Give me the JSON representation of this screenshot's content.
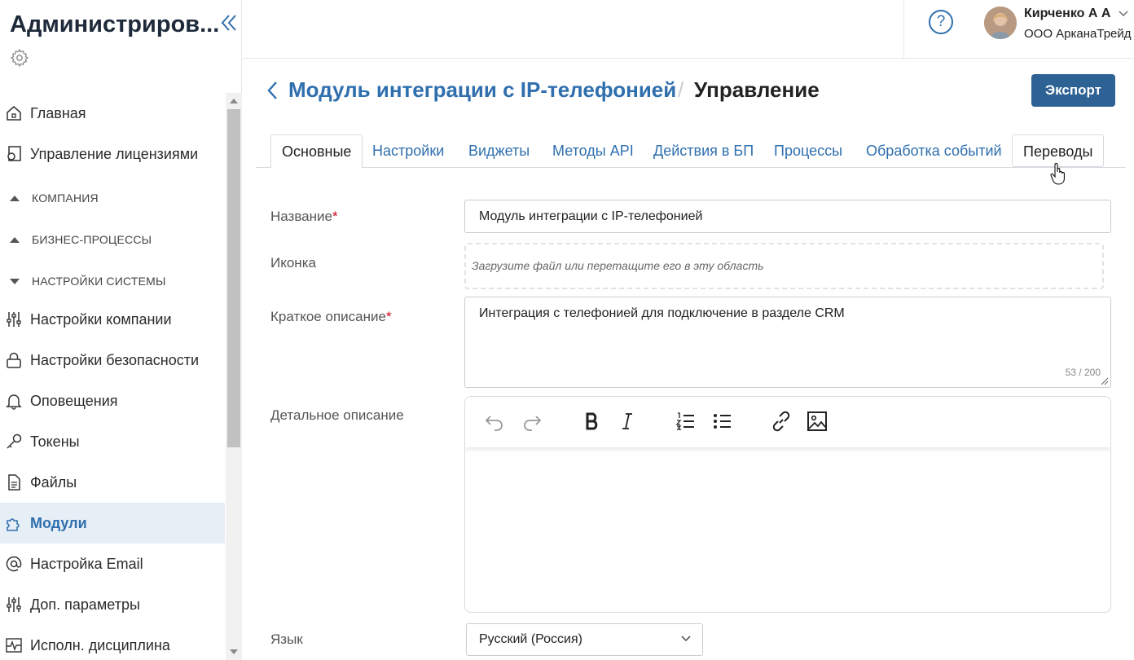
{
  "sidebar": {
    "title": "Администриров...",
    "items": [
      {
        "label": "Главная",
        "icon": "home-icon"
      },
      {
        "label": "Управление лицензиями",
        "icon": "license-icon"
      },
      {
        "label": "КОМПАНИЯ",
        "section": true,
        "state": "collapsed"
      },
      {
        "label": "БИЗНЕС-ПРОЦЕССЫ",
        "section": true,
        "state": "collapsed"
      },
      {
        "label": "НАСТРОЙКИ СИСТЕМЫ",
        "section": true,
        "state": "expanded"
      },
      {
        "label": "Настройки компании",
        "icon": "sliders-icon"
      },
      {
        "label": "Настройки безопасности",
        "icon": "lock-icon"
      },
      {
        "label": "Оповещения",
        "icon": "bell-icon"
      },
      {
        "label": "Токены",
        "icon": "key-icon"
      },
      {
        "label": "Файлы",
        "icon": "file-icon"
      },
      {
        "label": "Модули",
        "icon": "puzzle-icon",
        "active": true
      },
      {
        "label": "Настройка Email",
        "icon": "at-icon"
      },
      {
        "label": "Доп. параметры",
        "icon": "sliders-icon"
      },
      {
        "label": "Исполн. дисциплина",
        "icon": "pulse-icon"
      }
    ]
  },
  "header": {
    "help": "?",
    "user_name": "Кирченко А А",
    "user_org": "ООО АрканаТрейд"
  },
  "page": {
    "module_title": "Модуль интеграции с IP-телефонией",
    "separator": "/",
    "page_title": "Управление",
    "export_label": "Экспорт"
  },
  "tabs": [
    {
      "label": "Основные",
      "active": true
    },
    {
      "label": "Настройки"
    },
    {
      "label": "Виджеты"
    },
    {
      "label": "Методы API"
    },
    {
      "label": "Действия в БП"
    },
    {
      "label": "Процессы"
    },
    {
      "label": "Обработка событий"
    },
    {
      "label": "Переводы",
      "hover": true
    }
  ],
  "form": {
    "name_label": "Название",
    "required_mark": "*",
    "name_value": "Модуль интеграции с IP-телефонией",
    "icon_label": "Иконка",
    "icon_placeholder": "Загрузите файл или перетащите его в эту область",
    "short_label": "Краткое описание",
    "short_value": "Интеграция с телефонией для подключение в разделе CRM",
    "short_counter": "53 / 200",
    "detail_label": "Детальное описание",
    "language_label": "Язык",
    "language_value": "Русский (Россия)"
  },
  "colors": {
    "accent": "#2f6fae",
    "button": "#2f6294",
    "active_bg": "#e6eef6",
    "required": "#d0021b"
  }
}
